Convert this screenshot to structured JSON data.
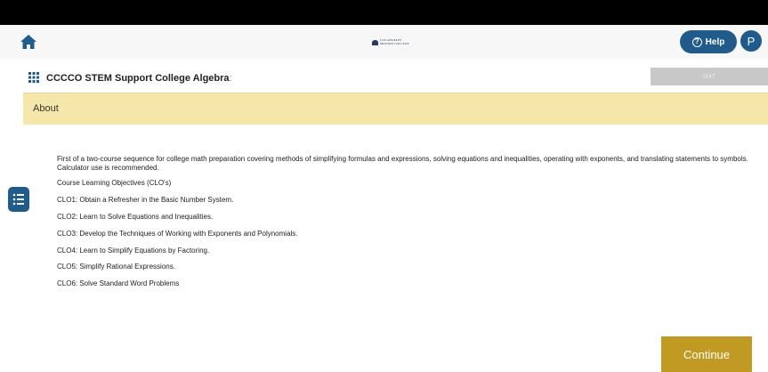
{
  "header": {
    "logo_text_line1": "LOS ANGELES",
    "logo_text_line2": "MISSION COLLEGE",
    "help_label": "Help",
    "avatar_initial": "P",
    "accent_color": "#1f5c8c"
  },
  "course": {
    "title": "CCCCO STEM Support College Algebra",
    "title_suffix": ":",
    "progress_text": "0/47"
  },
  "section": {
    "title": "About",
    "background_color": "#f5e6aa"
  },
  "content": {
    "intro": "First of a two-course sequence for college math preparation covering methods of simplifying formulas and expressions, solving equations and inequalities, operating with exponents, and translating statements to symbols. Calculator use is recommended.",
    "objectives_heading": "Course Learning Objectives (CLO's)",
    "objectives": [
      "CLO1: Obtain a Refresher in the Basic Number System.",
      "CLO2: Learn to Solve Equations and Inequalities.",
      "CLO3: Develop the Techniques of Working with Exponents and Polynomials.",
      "CLO4: Learn to Simplify Equations by Factoring.",
      "CLO5: Simplify Rational Expressions.",
      "CLO6: Solve Standard Word Problems"
    ]
  },
  "actions": {
    "continue_label": "Continue",
    "continue_color": "#c09a23"
  },
  "icons": {
    "home": "home-icon",
    "grid": "grid-icon",
    "help": "question-circle-icon",
    "side": "list-icon"
  }
}
